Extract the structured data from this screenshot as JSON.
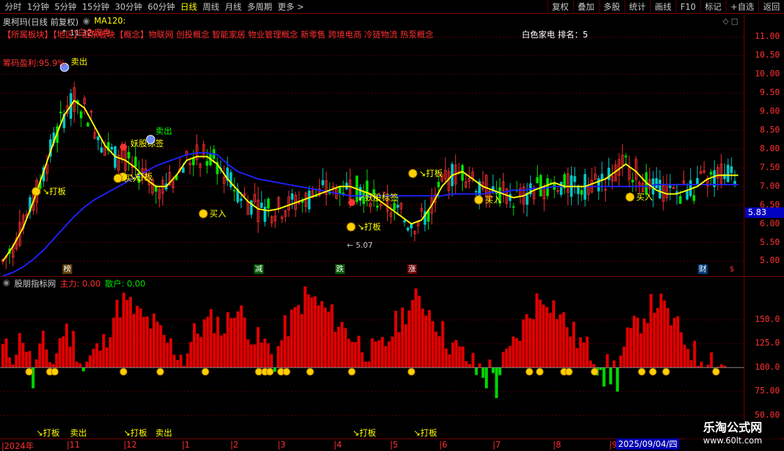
{
  "toolbar": {
    "periods": [
      "分时",
      "1分钟",
      "5分钟",
      "15分钟",
      "30分钟",
      "60分钟",
      "日线",
      "周线",
      "月线",
      "多周期",
      "更多 >"
    ],
    "active_period": "日线",
    "buttons": [
      "复权",
      "叠加",
      "多股",
      "统计",
      "画线",
      "F10",
      "标记",
      "+自选",
      "返回"
    ]
  },
  "main": {
    "title": "奥柯玛(日线 前复权)",
    "ma_label": "MA120:",
    "sectors": "【所属板块】【地区】山东板块【概念】物联网 创投概念 智能家居 物业管理概念 新零售 跨境电商 冷链物流 热泵概念",
    "overlay_text": "白色家电",
    "rank_text": "白色家电 排名：5",
    "chip_profit": "筹码盈利:95.9%",
    "high_label": "11.32",
    "low_label": "5.07",
    "current_price": "5.83",
    "y_ticks": [
      "11.00",
      "10.50",
      "10.00",
      "9.50",
      "9.00",
      "8.50",
      "8.00",
      "7.50",
      "7.00",
      "6.50",
      "6.00",
      "5.50",
      "5.00"
    ],
    "events": [
      {
        "label": "榜",
        "color": "#ffffff",
        "bg": "#5a3a00"
      },
      {
        "label": "减",
        "color": "#ffffff",
        "bg": "#005a00"
      },
      {
        "label": "跌",
        "color": "#ffffff",
        "bg": "#005a00"
      },
      {
        "label": "涨",
        "color": "#ffffff",
        "bg": "#6a0000"
      },
      {
        "label": "财",
        "color": "#ffffff",
        "bg": "#003a7a"
      },
      {
        "label": "$",
        "color": "#ff3030",
        "bg": "#000000"
      }
    ],
    "signals": {
      "buy": "买入",
      "sell": "卖出",
      "limit": "打板",
      "demon": "妖股标签"
    }
  },
  "sub": {
    "name": "股朋指标网",
    "main_force": "主力: 0.00",
    "retail": "散户: 0.00",
    "y_ticks": [
      "150.0",
      "125.0",
      "100.0",
      "75.00",
      "50.00"
    ],
    "bottom_signals": [
      "打板",
      "卖出",
      "打板",
      "卖出",
      "打板",
      "打板"
    ]
  },
  "dates": {
    "labels": [
      "2024年",
      "11",
      "12",
      "1",
      "2",
      "3",
      "4",
      "5",
      "6",
      "7",
      "8",
      "9"
    ],
    "cursor": "2025/09/04/四"
  },
  "watermark": {
    "title": "乐淘公式网",
    "url": "www.60lt.com"
  },
  "colors": {
    "up": "#ff3030",
    "down": "#00e000",
    "ma_fast": "#ffff00",
    "ma120": "#2020ff",
    "grid": "#7a0000"
  },
  "chart_data": {
    "type": "candlestick",
    "y_range": [
      4.6,
      11.6
    ],
    "ma_fast": [
      5.0,
      5.4,
      5.9,
      6.6,
      7.4,
      8.2,
      8.9,
      9.3,
      9.1,
      8.6,
      8.1,
      7.8,
      7.7,
      7.5,
      7.2,
      7.0,
      7.0,
      7.3,
      7.7,
      7.8,
      7.8,
      7.6,
      7.2,
      6.9,
      6.6,
      6.4,
      6.35,
      6.4,
      6.5,
      6.6,
      6.7,
      6.8,
      6.9,
      7.0,
      7.0,
      6.9,
      6.8,
      6.6,
      6.4,
      6.2,
      6.0,
      6.1,
      6.5,
      7.0,
      7.3,
      7.4,
      7.2,
      7.0,
      6.9,
      6.8,
      6.7,
      6.75,
      6.9,
      7.0,
      7.1,
      7.0,
      7.0,
      7.0,
      7.1,
      7.2,
      7.4,
      7.6,
      7.4,
      7.1,
      6.9,
      6.8,
      6.8,
      6.9,
      7.0,
      7.2,
      7.3,
      7.3,
      7.3
    ],
    "ma120": [
      4.6,
      4.7,
      4.85,
      5.05,
      5.3,
      5.6,
      5.9,
      6.2,
      6.45,
      6.65,
      6.8,
      6.95,
      7.1,
      7.25,
      7.4,
      7.55,
      7.65,
      7.75,
      7.85,
      7.9,
      7.9,
      7.85,
      7.6,
      7.4,
      7.3,
      7.2,
      7.15,
      7.1,
      7.05,
      7.0,
      6.95,
      6.9,
      6.85,
      6.8,
      6.75,
      6.75,
      6.75,
      6.75,
      6.75,
      6.75,
      6.75,
      6.75,
      6.75,
      6.75,
      6.8,
      6.8,
      6.8,
      6.8,
      6.85,
      6.85,
      6.9,
      6.9,
      6.95,
      6.95,
      7.0,
      7.0,
      7.0,
      7.0,
      7.0,
      7.0,
      7.0,
      7.0,
      7.0,
      7.0,
      7.05,
      7.05,
      7.05,
      7.05,
      7.05,
      7.05,
      7.05,
      7.05,
      7.05
    ],
    "sub_bars": [
      120,
      115,
      135,
      95,
      125,
      105,
      140,
      130,
      100,
      115,
      125,
      155,
      170,
      160,
      150,
      145,
      130,
      120,
      110,
      135,
      145,
      150,
      140,
      165,
      150,
      130,
      125,
      110,
      140,
      155,
      175,
      170,
      160,
      150,
      140,
      130,
      120,
      115,
      125,
      145,
      160,
      170,
      165,
      150,
      130,
      120,
      110,
      100,
      100,
      95,
      110,
      130,
      150,
      170,
      175,
      160,
      145,
      130,
      120,
      110,
      100,
      100,
      130,
      145,
      160,
      170,
      155,
      140,
      125,
      110,
      115,
      105,
      100
    ]
  }
}
